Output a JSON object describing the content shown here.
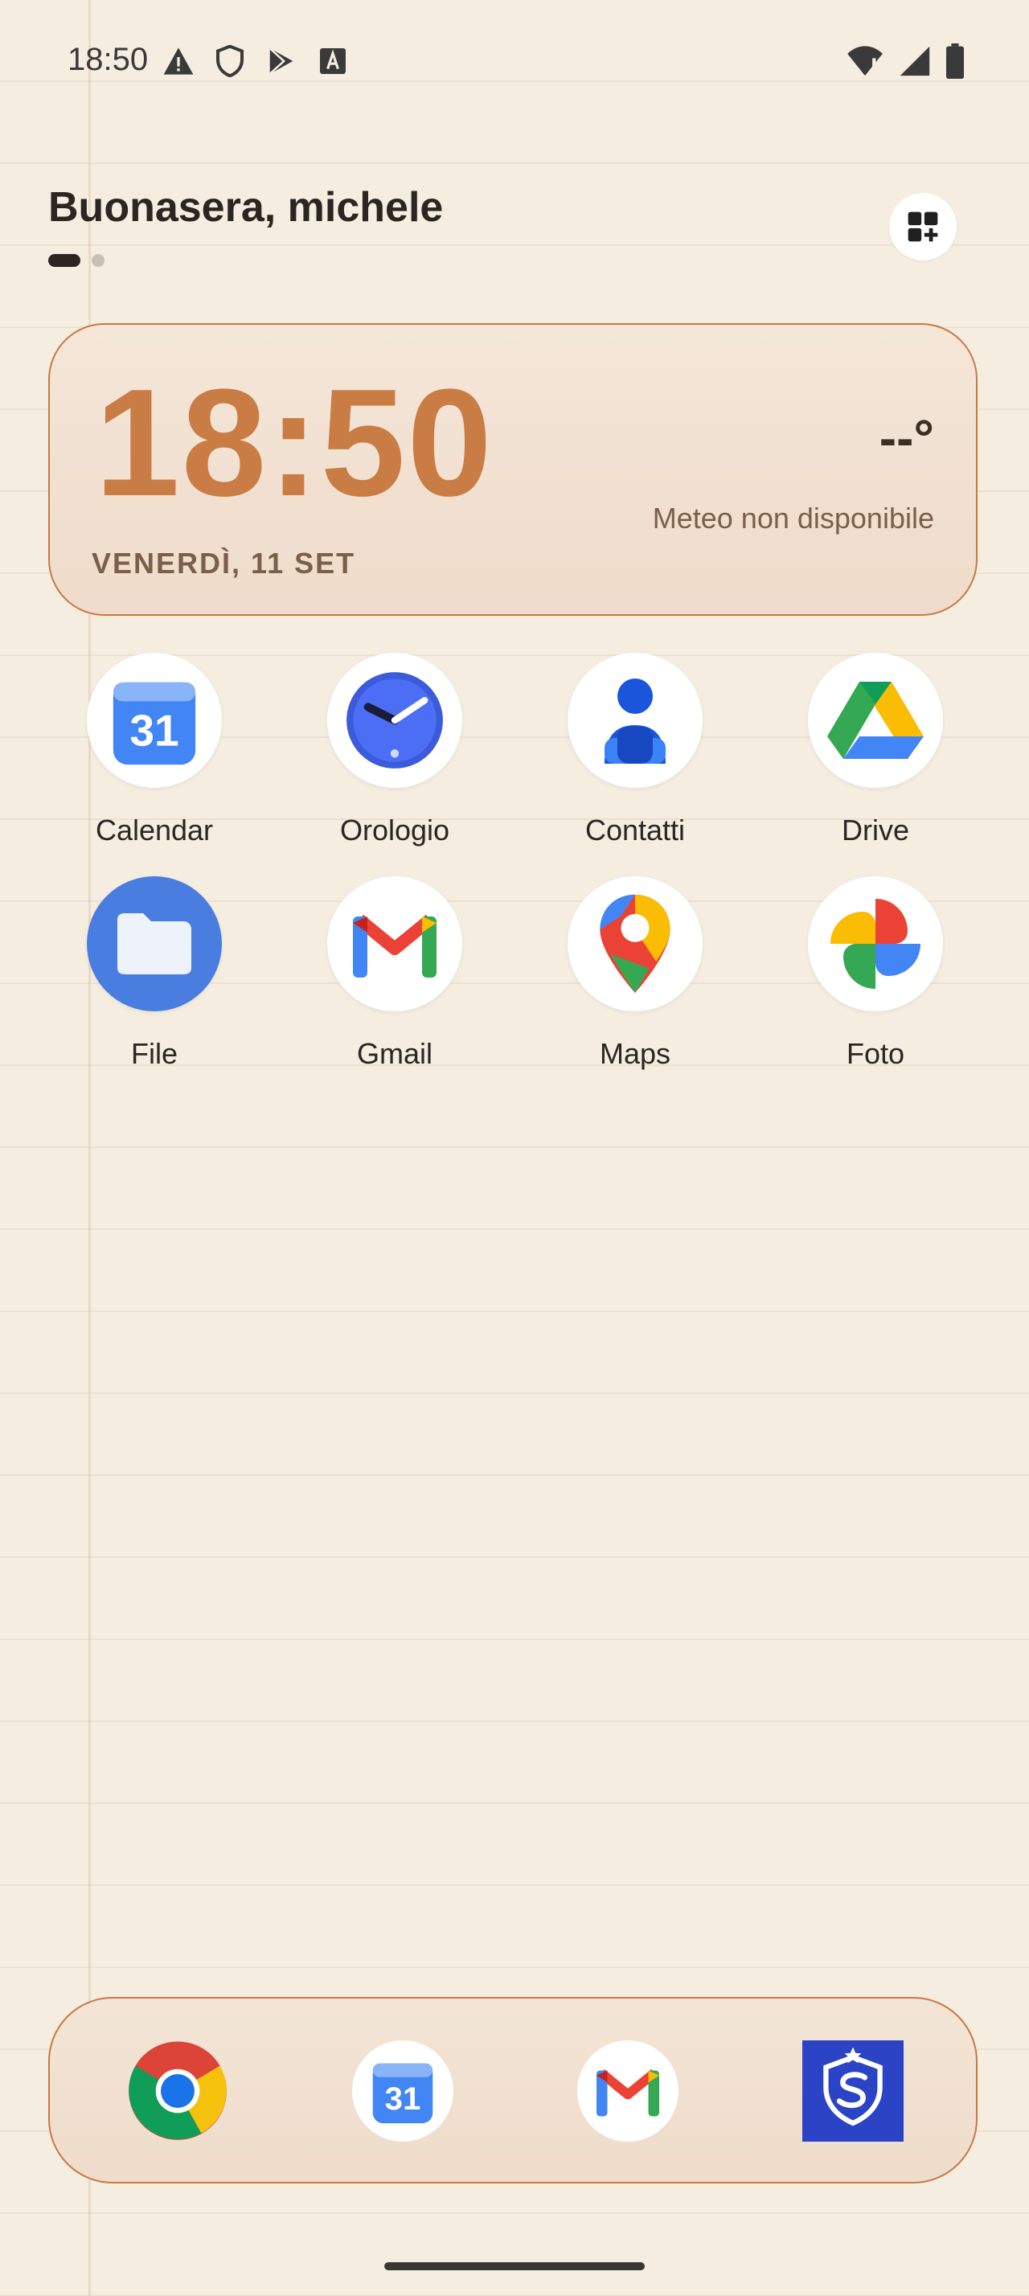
{
  "status_bar": {
    "time": "18:50",
    "left_icons": [
      "alert-icon",
      "shield-icon",
      "play-protect-icon",
      "font-a-icon"
    ],
    "right_icons": [
      "wifi-alert-icon",
      "signal-icon",
      "battery-icon"
    ]
  },
  "header": {
    "greeting": "Buonasera, michele",
    "pages": 2,
    "current_page": 1
  },
  "clock_widget": {
    "time": "18:50",
    "date": "VENERDÌ, 11 SET",
    "weather_temp": "--°",
    "weather_status": "Meteo non disponibile"
  },
  "apps": [
    {
      "label": "Calendar",
      "icon": "calendar-icon"
    },
    {
      "label": "Orologio",
      "icon": "clock-icon"
    },
    {
      "label": "Contatti",
      "icon": "contacts-icon"
    },
    {
      "label": "Drive",
      "icon": "drive-icon"
    },
    {
      "label": "File",
      "icon": "files-icon"
    },
    {
      "label": "Gmail",
      "icon": "gmail-icon"
    },
    {
      "label": "Maps",
      "icon": "maps-icon"
    },
    {
      "label": "Foto",
      "icon": "photos-icon"
    }
  ],
  "dock": [
    {
      "icon": "chrome-icon"
    },
    {
      "icon": "calendar-icon",
      "day": "31"
    },
    {
      "icon": "gmail-icon"
    },
    {
      "icon": "security-shield-icon"
    }
  ],
  "calendar_day": "31",
  "colors": {
    "accent": "#c97d44",
    "background": "#f4ede0"
  }
}
